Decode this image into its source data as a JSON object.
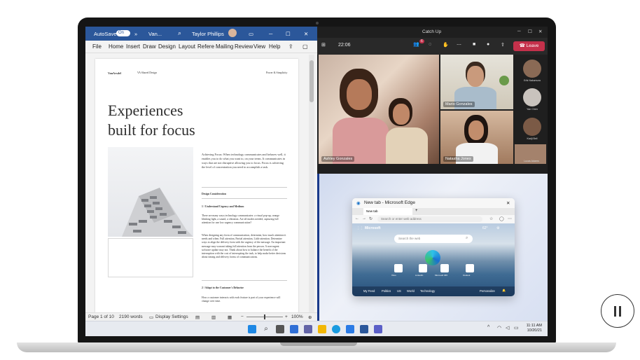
{
  "word": {
    "autosave": "AutoSave",
    "autosave_state": "On",
    "doc_name": "Van...",
    "user": "Taylor Phillips",
    "menu": [
      "File",
      "Home",
      "Insert",
      "Draw",
      "Design",
      "Layout",
      "Refere",
      "Mailing",
      "Review",
      "View",
      "Help"
    ],
    "doc": {
      "brand": "VanArsdel",
      "header_mid": "VA Shared Design",
      "header_right": "Power & Simplicity",
      "title_line1": "Experiences",
      "title_line2": "built for focus",
      "intro": "Achieving Focus: When technology communicates and behaves well, it enables you to do what you want to, on your terms. It communicates in ways that are not disruptive allowing you to focus. Focus is achieving the level of concentration you need to accomplish a task.",
      "section": "Design Consideration",
      "h1": "1 / Understand Urgency and Medium",
      "p1": "There are many ways technology communicates: a visual pop-up, orange blinking light, a sound, a vibration. Are all modes needed, capturing full attention for one low urgency communication?",
      "p2": "When designing any form of communication, determine, how much attention it needs and when. Full attention, Partial attention, Little attention. Determine ways to align the delivery form with the urgency of the message. An important message may warrant taking full attention from the person. A non-urgent software update may not. Think about how to balance the benefit of the interruption with the cost of interrupting the task, to help make better decisions about timing and delivery forms of communications.",
      "h2": "2 / Adapt to the Customer's Behavior",
      "p3": "How a customer interacts with each feature is part of your experience will change over time."
    },
    "status": {
      "page": "Page 1 of 10",
      "words": "2190 words",
      "display": "Display Settings",
      "zoom": "100%"
    }
  },
  "teams": {
    "title": "Catch Up",
    "timer": "22:06",
    "leave": "Leave",
    "badge": "6",
    "tiles": [
      "Ashley Gonzales",
      "Mario Gonzales",
      "Natasha Jones"
    ],
    "side": [
      "Erik Nakamura",
      "Yan Chen",
      "Kadji Bell",
      "Lucas Adams"
    ]
  },
  "edge": {
    "title": "New tab - Microsoft Edge",
    "tab": "New tab",
    "address_placeholder": "Search or enter web address",
    "brand": "Microsoft",
    "search_placeholder": "Search the web",
    "weather": "62°",
    "quick": [
      "Xbox",
      "LinkedIn",
      "Microsoft 365",
      "Outlook"
    ],
    "feed_tabs": [
      "My Feed",
      "Politics",
      "US",
      "World",
      "Technology"
    ],
    "personalize": "Personalize"
  },
  "taskbar": {
    "time": "11:11 AM",
    "date": "10/20/21"
  },
  "colors": {
    "word": "#2b579a",
    "teams_leave": "#c4314b",
    "teams_bg": "#1f1f1f"
  }
}
